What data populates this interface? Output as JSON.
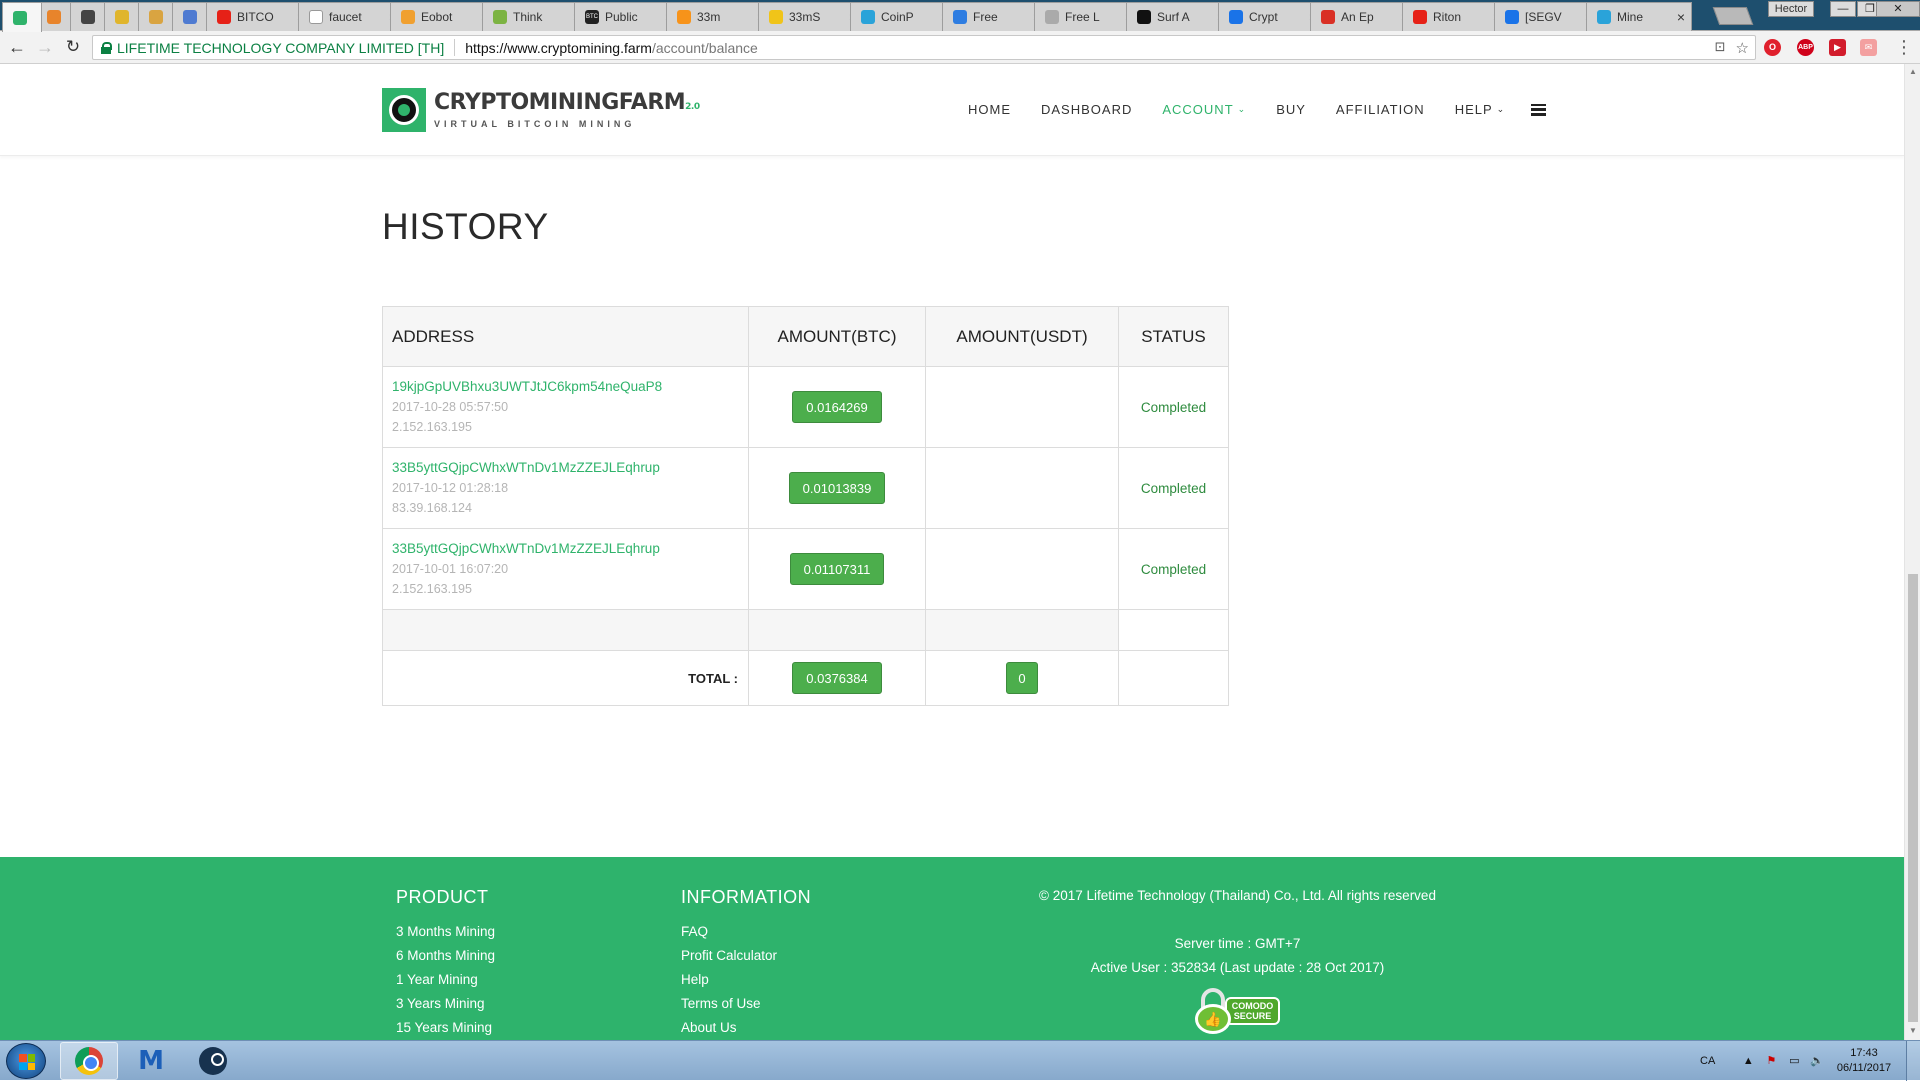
{
  "browser": {
    "tabs": [
      {
        "title": "",
        "favicon_color": "#2fb36b",
        "favicon": "circle-icon",
        "active": true,
        "iconly": true
      },
      {
        "title": "",
        "favicon_color": "#e8842b",
        "favicon": "droplet-icon",
        "iconly": true
      },
      {
        "title": "",
        "favicon_color": "#444444",
        "favicon": "b-icon",
        "iconly": true
      },
      {
        "title": "",
        "favicon_color": "#e0b52c",
        "favicon": "coin-icon",
        "iconly": true
      },
      {
        "title": "",
        "favicon_color": "#d9a441",
        "favicon": "bulb-icon",
        "iconly": true
      },
      {
        "title": "",
        "favicon_color": "#4f7bd1",
        "favicon": "bars-icon",
        "iconly": true
      },
      {
        "title": "BITCO",
        "favicon_color": "#e62117",
        "favicon": "youtube-icon"
      },
      {
        "title": "faucet",
        "favicon_color": "#ffffff",
        "favicon": "page-icon"
      },
      {
        "title": "Eobot",
        "favicon_color": "#f0a030",
        "favicon": "eobot-icon"
      },
      {
        "title": "Think",
        "favicon_color": "#7cb342",
        "favicon": "think-icon"
      },
      {
        "title": "Public",
        "favicon_color": "#222222",
        "favicon": "btc-icon",
        "favicon_text": "BTC"
      },
      {
        "title": "33m",
        "favicon_color": "#f7931a",
        "favicon": "bitcoin-icon"
      },
      {
        "title": "33mS",
        "favicon_color": "#f0c419",
        "favicon": "dogecoin-icon"
      },
      {
        "title": "CoinP",
        "favicon_color": "#2aa3d9",
        "favicon": "coinpot-icon"
      },
      {
        "title": "Free",
        "favicon_color": "#2e7de1",
        "favicon": "ripple-icon"
      },
      {
        "title": "Free L",
        "favicon_color": "#aaaaaa",
        "favicon": "litecoin-icon"
      },
      {
        "title": "Surf A",
        "favicon_color": "#111111",
        "favicon": "surf-icon"
      },
      {
        "title": "Crypt",
        "favicon_color": "#1a73e8",
        "favicon": "crypt-icon"
      },
      {
        "title": "An Ep",
        "favicon_color": "#d93025",
        "favicon": "slack-icon"
      },
      {
        "title": "Riton",
        "favicon_color": "#e62117",
        "favicon": "youtube-icon"
      },
      {
        "title": "[SEGV",
        "favicon_color": "#1a73e8",
        "favicon": "b-blue-icon"
      },
      {
        "title": "Mine",
        "favicon_color": "#2aa3d9",
        "favicon": "mine-icon"
      }
    ],
    "window_user": "Hector",
    "cert_name": "LIFETIME TECHNOLOGY COMPANY LIMITED [TH]",
    "url_host": "https://www.cryptomining.farm",
    "url_path": "/account/balance"
  },
  "site": {
    "logo_main": "CRYPTOMININGFARM",
    "logo_version": "2.0",
    "logo_sub": "VIRTUAL BITCOIN MINING",
    "menu": [
      {
        "label": "HOME"
      },
      {
        "label": "DASHBOARD"
      },
      {
        "label": "ACCOUNT",
        "dropdown": true,
        "active": true
      },
      {
        "label": "BUY"
      },
      {
        "label": "AFFILIATION"
      },
      {
        "label": "HELP",
        "dropdown": true
      }
    ],
    "accent_color": "#2fb36b"
  },
  "history": {
    "title": "HISTORY",
    "headers": {
      "address": "ADDRESS",
      "amount_btc": "AMOUNT(BTC)",
      "amount_usdt": "AMOUNT(USDT)",
      "status": "STATUS"
    },
    "rows": [
      {
        "address": "19kjpGpUVBhxu3UWTJtJC6kpm54neQuaP8",
        "date": "2017-10-28 05:57:50",
        "ip": "2.152.163.195",
        "btc": "0.0164269",
        "usdt": "",
        "status": "Completed"
      },
      {
        "address": "33B5yttGQjpCWhxWTnDv1MzZZEJLEqhrup",
        "date": "2017-10-12 01:28:18",
        "ip": "83.39.168.124",
        "btc": "0.01013839",
        "usdt": "",
        "status": "Completed"
      },
      {
        "address": "33B5yttGQjpCWhxWTnDv1MzZZEJLEqhrup",
        "date": "2017-10-01 16:07:20",
        "ip": "2.152.163.195",
        "btc": "0.01107311",
        "usdt": "",
        "status": "Completed"
      }
    ],
    "total_label": "TOTAL :",
    "total_btc": "0.0376384",
    "total_usdt": "0"
  },
  "footer": {
    "product_heading": "PRODUCT",
    "product_links": [
      "3 Months Mining",
      "6 Months Mining",
      "1 Year Mining",
      "3 Years Mining",
      "15 Years Mining"
    ],
    "info_heading": "INFORMATION",
    "info_links": [
      "FAQ",
      "Profit Calculator",
      "Help",
      "Terms of Use",
      "About Us"
    ],
    "copyright": "© 2017 Lifetime Technology (Thailand) Co., Ltd. All rights reserved",
    "server_time": "Server time : GMT+7",
    "active_user": "Active User : 352834 (Last update : 28 Oct 2017)",
    "badge_line1": "COMODO",
    "badge_line2": "SECURE"
  },
  "taskbar": {
    "language": "CA",
    "time": "17:43",
    "date": "06/11/2017"
  }
}
